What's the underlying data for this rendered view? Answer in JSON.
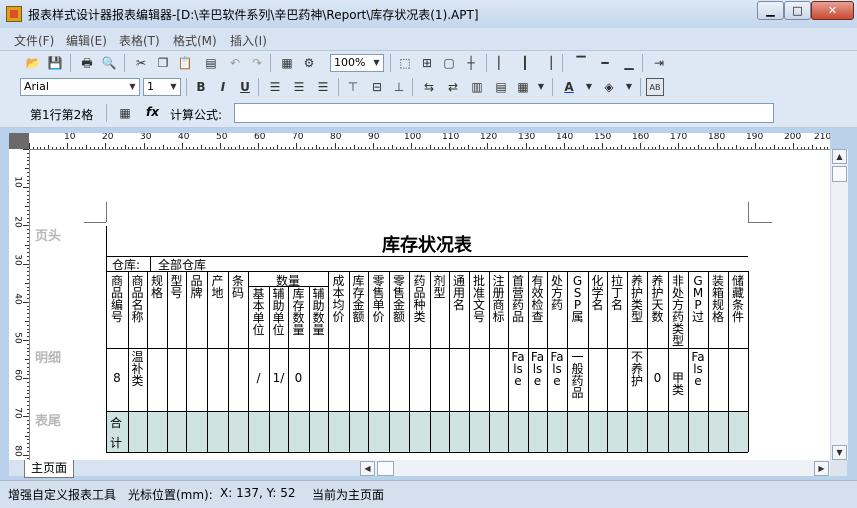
{
  "window": {
    "title": "报表样式设计器报表编辑器-[D:\\辛巴软件系列\\辛巴药神\\Report\\库存状况表(1).APT]"
  },
  "menu": [
    "文件(F)",
    "编辑(E)",
    "表格(T)",
    "格式(M)",
    "插入(I)"
  ],
  "toolbar_format": {
    "font": "Arial",
    "size": "1",
    "zoom": "100%"
  },
  "formula_bar": {
    "cell_ref": "第1行第2格",
    "fx": "fx",
    "formula_label": "计算公式:",
    "formula_value": ""
  },
  "ruler": {
    "top": [
      "10",
      "20",
      "30",
      "40",
      "50",
      "60",
      "70",
      "80",
      "90",
      "100",
      "110",
      "120",
      "130",
      "140",
      "150",
      "160",
      "170",
      "180",
      "190",
      "200",
      "210"
    ],
    "left": [
      "10",
      "20",
      "30",
      "40",
      "50",
      "60",
      "70",
      "80"
    ]
  },
  "sections": {
    "header": "页头",
    "detail": "明细",
    "footer": "表尾"
  },
  "report": {
    "title": "库存状况表",
    "warehouse_label": "仓库:",
    "warehouse_value": "全部仓库",
    "group_header": "数量",
    "columns": [
      "商品编号",
      "商品名称",
      "规格",
      "型号",
      "品牌",
      "产地",
      "条码",
      "基本单位",
      "辅助单位",
      "库存数量",
      "辅助数量",
      "成本均价",
      "库存金额",
      "零售单价",
      "零售金额",
      "药品种类",
      "剂型",
      "通用名",
      "批准文号",
      "注册商标",
      "首营药品",
      "有效检查",
      "处方药",
      "GSP属",
      "化学名",
      "拉丁名",
      "养护类型",
      "养护天数",
      "非处方药类型",
      "GMP过",
      "装箱规格",
      "储藏条件"
    ],
    "detail": [
      "8",
      "温补类",
      "",
      "",
      "",
      "",
      "",
      "/",
      "1/",
      "0",
      "",
      "",
      "",
      "",
      "",
      "",
      "",
      "",
      "",
      "",
      "False",
      "False",
      "False",
      "一般药品",
      "",
      "",
      "不养护",
      "0",
      "甲类",
      "False",
      "",
      ""
    ],
    "footer_label": "合计"
  },
  "tabs": {
    "main": "主页面"
  },
  "status": {
    "app": "增强自定义报表工具",
    "pos_label": "光标位置(mm):",
    "pos_value": "X: 137, Y: 52",
    "page": "当前为主页面"
  }
}
